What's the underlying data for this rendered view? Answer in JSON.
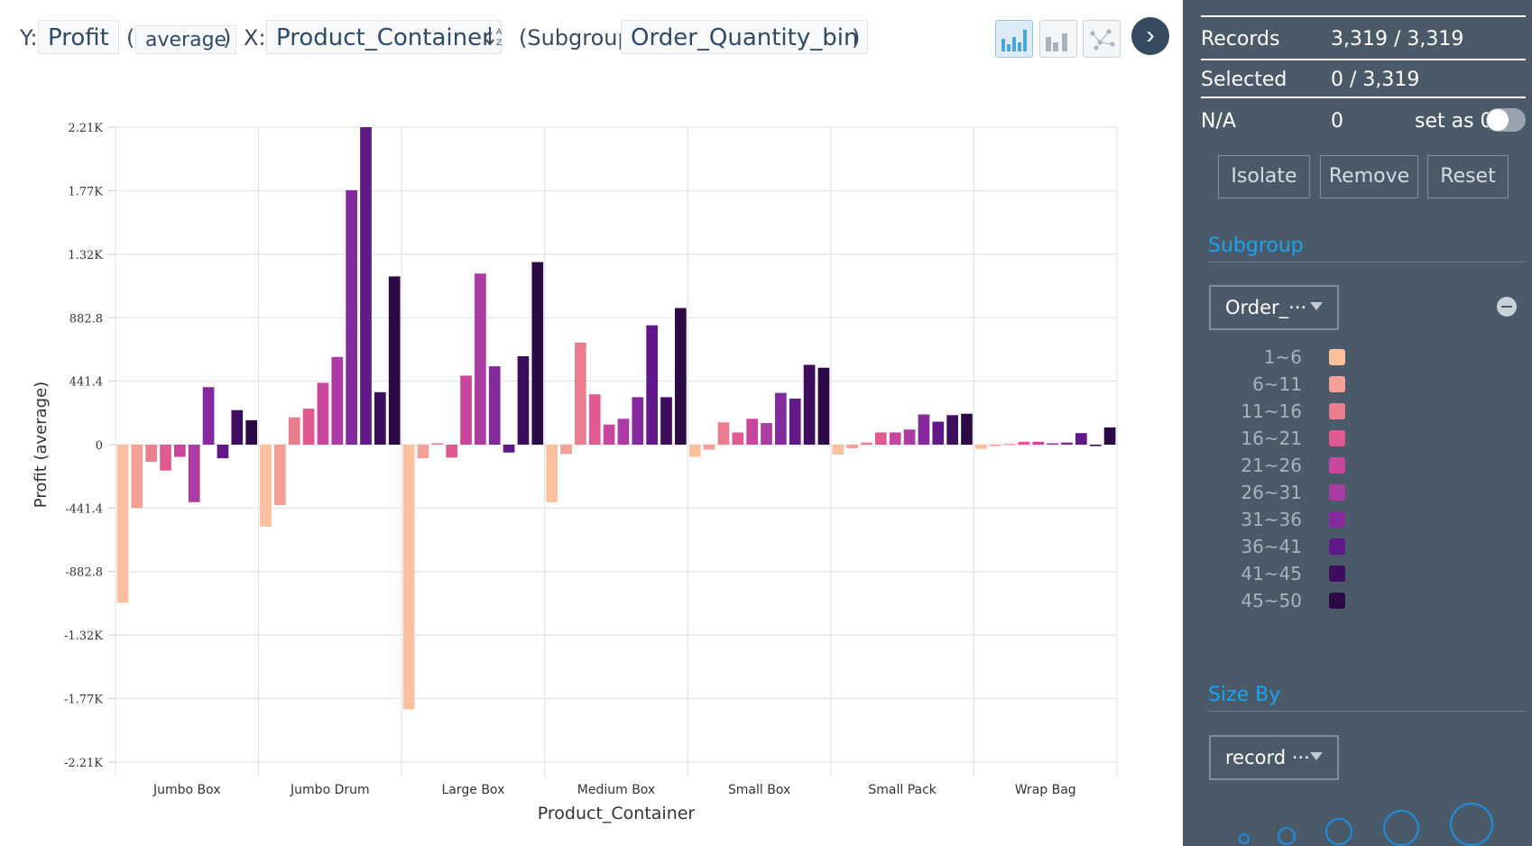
{
  "header": {
    "y_prefix": "Y:",
    "y_field": "Profit",
    "open_paren": "(",
    "aggregate": "average",
    "close_paren": ")",
    "x_prefix": "X:",
    "x_field": "Product_Container",
    "sort_icon": "sort-alpha-icon",
    "subgroup_prefix": "(Subgroup:",
    "subgroup_field": "Order_Quantity_bin",
    "subgroup_close": ")",
    "chart_types": [
      "bar-chart-icon",
      "grouped-bar-icon",
      "scatter-icon"
    ],
    "active_chart_type": "bar-chart-icon",
    "next_icon": "chevron-right-icon"
  },
  "panel": {
    "records_label": "Records",
    "records_value": "3,319 / 3,319",
    "selected_label": "Selected",
    "selected_value": "0 / 3,319",
    "na_label": "N/A",
    "na_value": "0",
    "set_as_zero_label": "set as 0",
    "set_as_zero_on": false,
    "buttons": {
      "isolate": "Isolate",
      "remove": "Remove",
      "reset": "Reset"
    },
    "subgroup_title": "Subgroup",
    "subgroup_dropdown": "Order_···",
    "size_by_title": "Size By",
    "size_by_dropdown": "record ···",
    "accent_color": "#1aa3f0",
    "panel_color": "#4b5a69"
  },
  "chart_data": {
    "type": "bar",
    "xlabel": "Product_Container",
    "ylabel": "Profit (average)",
    "categories": [
      "Jumbo Box",
      "Jumbo Drum",
      "Large Box",
      "Medium Box",
      "Small Box",
      "Small Pack",
      "Wrap Bag"
    ],
    "yticks": [
      2208,
      1766,
      1324,
      882.8,
      441.4,
      0,
      -441.4,
      -882.8,
      -1324,
      -1766,
      -2208
    ],
    "ytick_labels": [
      "2.21K",
      "1.77K",
      "1.32K",
      "882.8",
      "441.4",
      "0",
      "-441.4",
      "-882.8",
      "-1.32K",
      "-1.77K",
      "-2.21K"
    ],
    "ylim": [
      -2208,
      2208
    ],
    "grid": true,
    "legend_position": "right-panel",
    "series": [
      {
        "name": "1~6",
        "color": "#fbc09d",
        "values": [
          -1100,
          -570,
          -1840,
          -400,
          -85,
          -70,
          -30
        ]
      },
      {
        "name": "6~11",
        "color": "#f4a097",
        "values": [
          -440,
          -420,
          -95,
          -65,
          -35,
          -25,
          -10
        ]
      },
      {
        "name": "11~16",
        "color": "#ec7d8e",
        "values": [
          -120,
          190,
          10,
          710,
          155,
          15,
          5
        ]
      },
      {
        "name": "16~21",
        "color": "#e05a91",
        "values": [
          -180,
          250,
          -90,
          350,
          85,
          85,
          20
        ]
      },
      {
        "name": "21~26",
        "color": "#c9469d",
        "values": [
          -85,
          430,
          480,
          140,
          180,
          85,
          20
        ]
      },
      {
        "name": "26~31",
        "color": "#ab3ca3",
        "values": [
          -400,
          610,
          1190,
          180,
          150,
          105,
          10
        ]
      },
      {
        "name": "31~36",
        "color": "#85299f",
        "values": [
          400,
          1770,
          545,
          330,
          360,
          210,
          15
        ]
      },
      {
        "name": "36~41",
        "color": "#61198a",
        "values": [
          -95,
          2208,
          -55,
          830,
          320,
          160,
          80
        ]
      },
      {
        "name": "41~45",
        "color": "#3f0d5e",
        "values": [
          240,
          365,
          615,
          330,
          555,
          205,
          -10
        ]
      },
      {
        "name": "45~50",
        "color": "#2b0a45",
        "values": [
          170,
          1170,
          1270,
          950,
          535,
          215,
          120
        ]
      }
    ]
  }
}
